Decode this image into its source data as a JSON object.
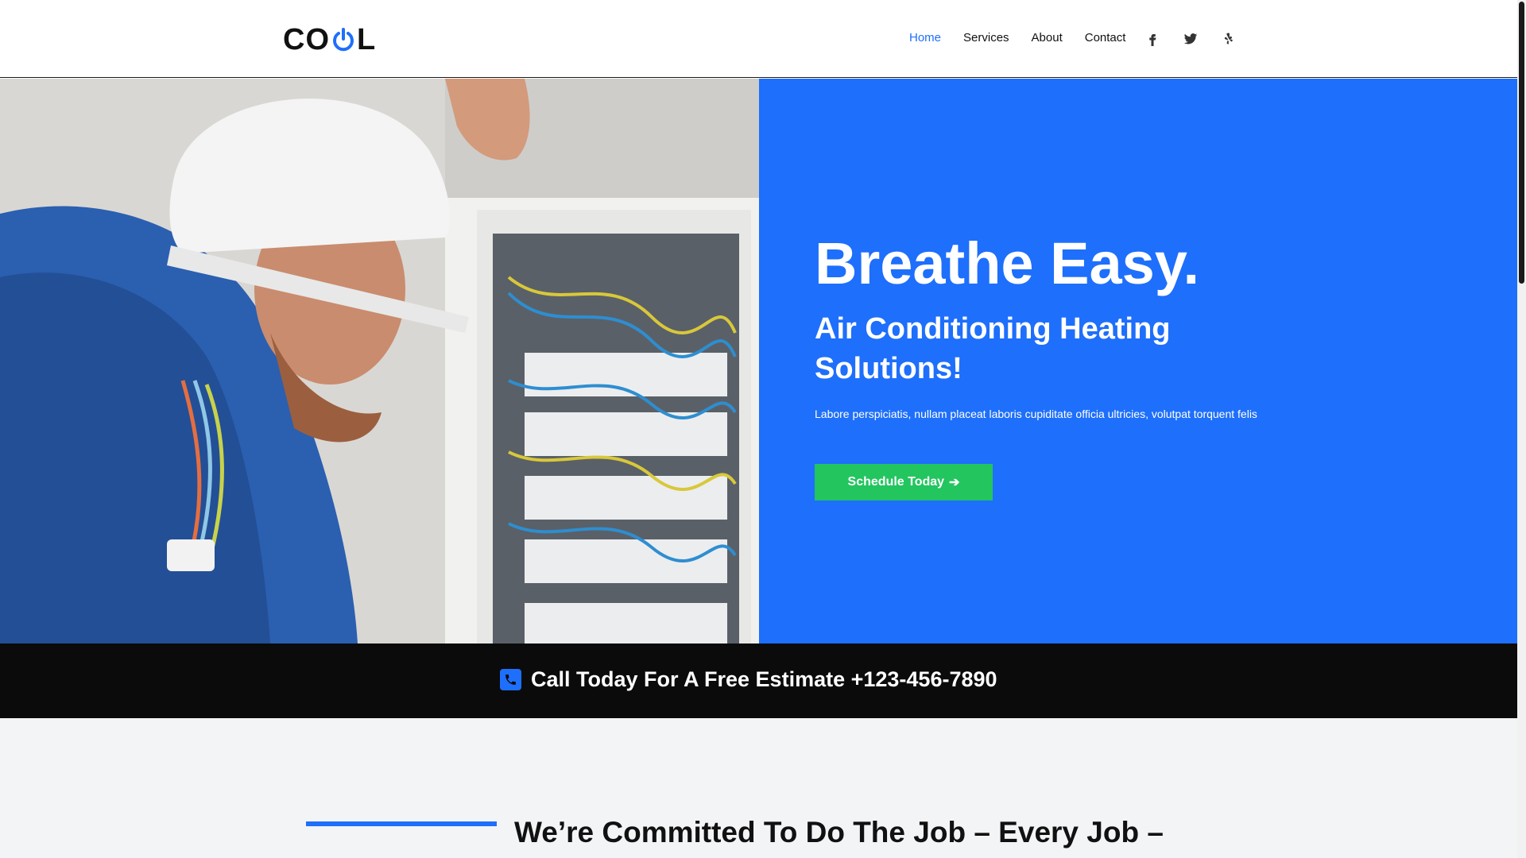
{
  "brand": {
    "logo_text_left": "CO",
    "logo_text_right": "L",
    "accent": "#1e6ffb"
  },
  "nav": {
    "items": [
      {
        "label": "Home",
        "active": true
      },
      {
        "label": "Services",
        "active": false
      },
      {
        "label": "About",
        "active": false
      },
      {
        "label": "Contact",
        "active": false
      }
    ],
    "socials": [
      "facebook-icon",
      "twitter-icon",
      "yelp-icon"
    ]
  },
  "hero": {
    "title": "Breathe Easy.",
    "subtitle": "Air Conditioning Heating Solutions!",
    "text": "Labore perspiciatis, nullam placeat laboris cupiditate officia ultricies, volutpat torquent felis",
    "cta_label": "Schedule Today",
    "panel_color": "#1e6ffb",
    "cta_color": "#22c55e"
  },
  "callbar": {
    "text": "Call Today For A Free Estimate +123-456-7890"
  },
  "section2": {
    "title": "We’re Committed To Do The Job – Every Job –"
  }
}
